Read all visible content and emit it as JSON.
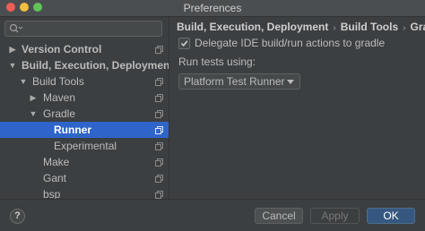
{
  "window": {
    "title": "Preferences"
  },
  "search": {
    "value": "",
    "placeholder": ""
  },
  "tree": {
    "items": [
      {
        "label": "Version Control"
      },
      {
        "label": "Build, Execution, Deployment"
      },
      {
        "label": "Build Tools"
      },
      {
        "label": "Maven"
      },
      {
        "label": "Gradle"
      },
      {
        "label": "Runner"
      },
      {
        "label": "Experimental"
      },
      {
        "label": "Make"
      },
      {
        "label": "Gant"
      },
      {
        "label": "bsp"
      }
    ]
  },
  "breadcrumb": {
    "items": [
      "Build, Execution, Deployment",
      "Build Tools",
      "Gradle"
    ],
    "separator": "›"
  },
  "settings": {
    "delegate_checkbox": {
      "label": "Delegate IDE build/run actions to gradle",
      "checked": true
    },
    "run_tests_label": "Run tests using:",
    "run_tests_select": {
      "value": "Platform Test Runner"
    }
  },
  "footer": {
    "help_label": "?",
    "cancel_label": "Cancel",
    "apply_label": "Apply",
    "ok_label": "OK"
  },
  "colors": {
    "background": "#3c3f41",
    "selection": "#2f65ca",
    "ok_button": "#365880",
    "text": "#bbbbbb"
  },
  "icons": [
    "search-icon",
    "copy-icon",
    "chevron-right-icon",
    "chevron-down-icon",
    "check-icon",
    "dropdown-caret-icon",
    "help-icon"
  ]
}
